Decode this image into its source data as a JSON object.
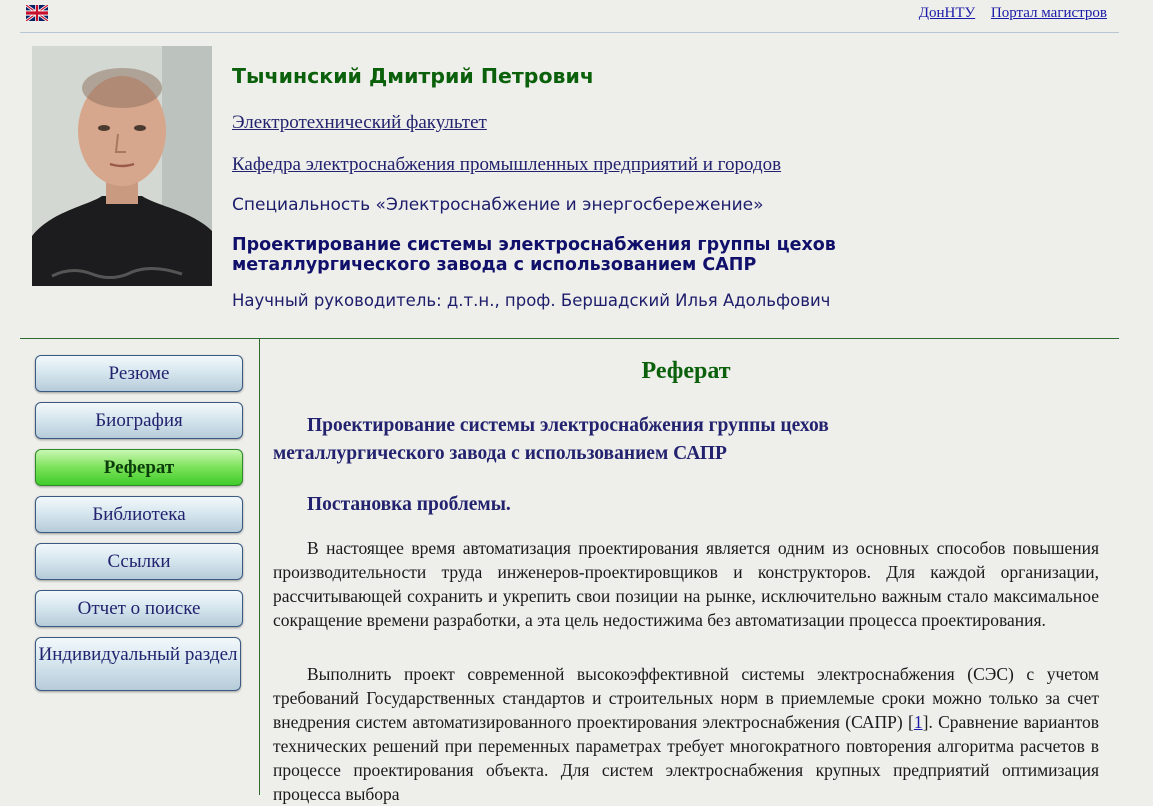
{
  "top": {
    "flag_icon": "uk-flag-icon",
    "links": [
      "ДонНТУ",
      "Портал магистров"
    ]
  },
  "header": {
    "name": "Тычинский Дмитрий Петрович",
    "faculty": "Электротехнический факультет",
    "department": "Кафедра электроснабжения промышленных предприятий и городов",
    "speciality": "Специальность «Электроснабжение и энергосбережение»",
    "topic": "Проектирование системы электроснабжения группы цехов металлургического завода с использованием САПР",
    "supervisor": "Научный руководитель: д.т.н., проф. Бершадский Илья Адольфович"
  },
  "nav": {
    "items": [
      "Резюме",
      "Биография",
      "Реферат",
      "Библиотека",
      "Ссылки",
      "Отчет о поиске",
      "Индивидуальный раздел"
    ],
    "active": "Реферат"
  },
  "content": {
    "title": "Реферат",
    "subtitle": "Проектирование системы электроснабжения группы цехов металлургического завода с использованием САПР",
    "section": "Постановка проблемы.",
    "p1": "В настоящее время автоматизация проектирования является одним из основных способов повышения производительности труда инженеров-проектировщиков и конструкторов. Для каждой организации, рассчитывающей сохранить и укрепить свои позиции на рынке, исключительно важным стало максимальное сокращение времени разработки, а эта цель недостижима без автоматизации процесса проектирования.",
    "p2_before": "Выполнить проект современной высокоэффективной системы электроснабжения (СЭС) с учетом требований Государственных стандартов и строительных норм в приемлемые сроки можно только за счет внедрения систем автоматизированного проектирования электроснабжения (САПР) [",
    "p2_ref": "1",
    "p2_after": "]. Сравнение вариантов технических решений при переменных параметрах требует многократного повторения алгоритма расчетов в процессе проектирования объекта. Для систем электроснабжения крупных предприятий оптимизация процесса выбора"
  },
  "colors": {
    "name": "#0b610b",
    "link": "#1a1aa8",
    "nav_text": "#22226e",
    "active_button": "#5ad23c",
    "background": "#eeeeea"
  }
}
